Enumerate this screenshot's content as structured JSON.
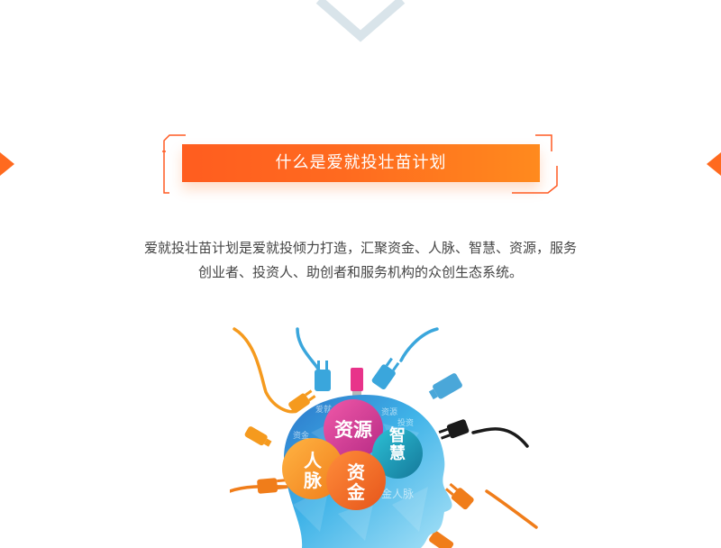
{
  "section": {
    "title": "什么是爱就投壮苗计划",
    "description_lines": [
      "爱就投壮苗计划是爱就投倾力打造，汇聚资金、人脉、智慧、资源，服务",
      "创业者、投资人、助创者和服务机构的众创生态系统。"
    ]
  },
  "illustration": {
    "bubbles": {
      "resources": "资源",
      "wisdom": "智慧",
      "network": "人脉",
      "funds": "资金"
    },
    "faint_words": [
      "爱就",
      "资源",
      "资金",
      "投资",
      "金人脉"
    ]
  },
  "colors": {
    "accent_orange": "#ff6a1f",
    "chevron_gray": "#d9e4ea",
    "plug_blue": "#3aa6dc",
    "plug_orange": "#f58220",
    "plug_pink": "#e8338a"
  }
}
